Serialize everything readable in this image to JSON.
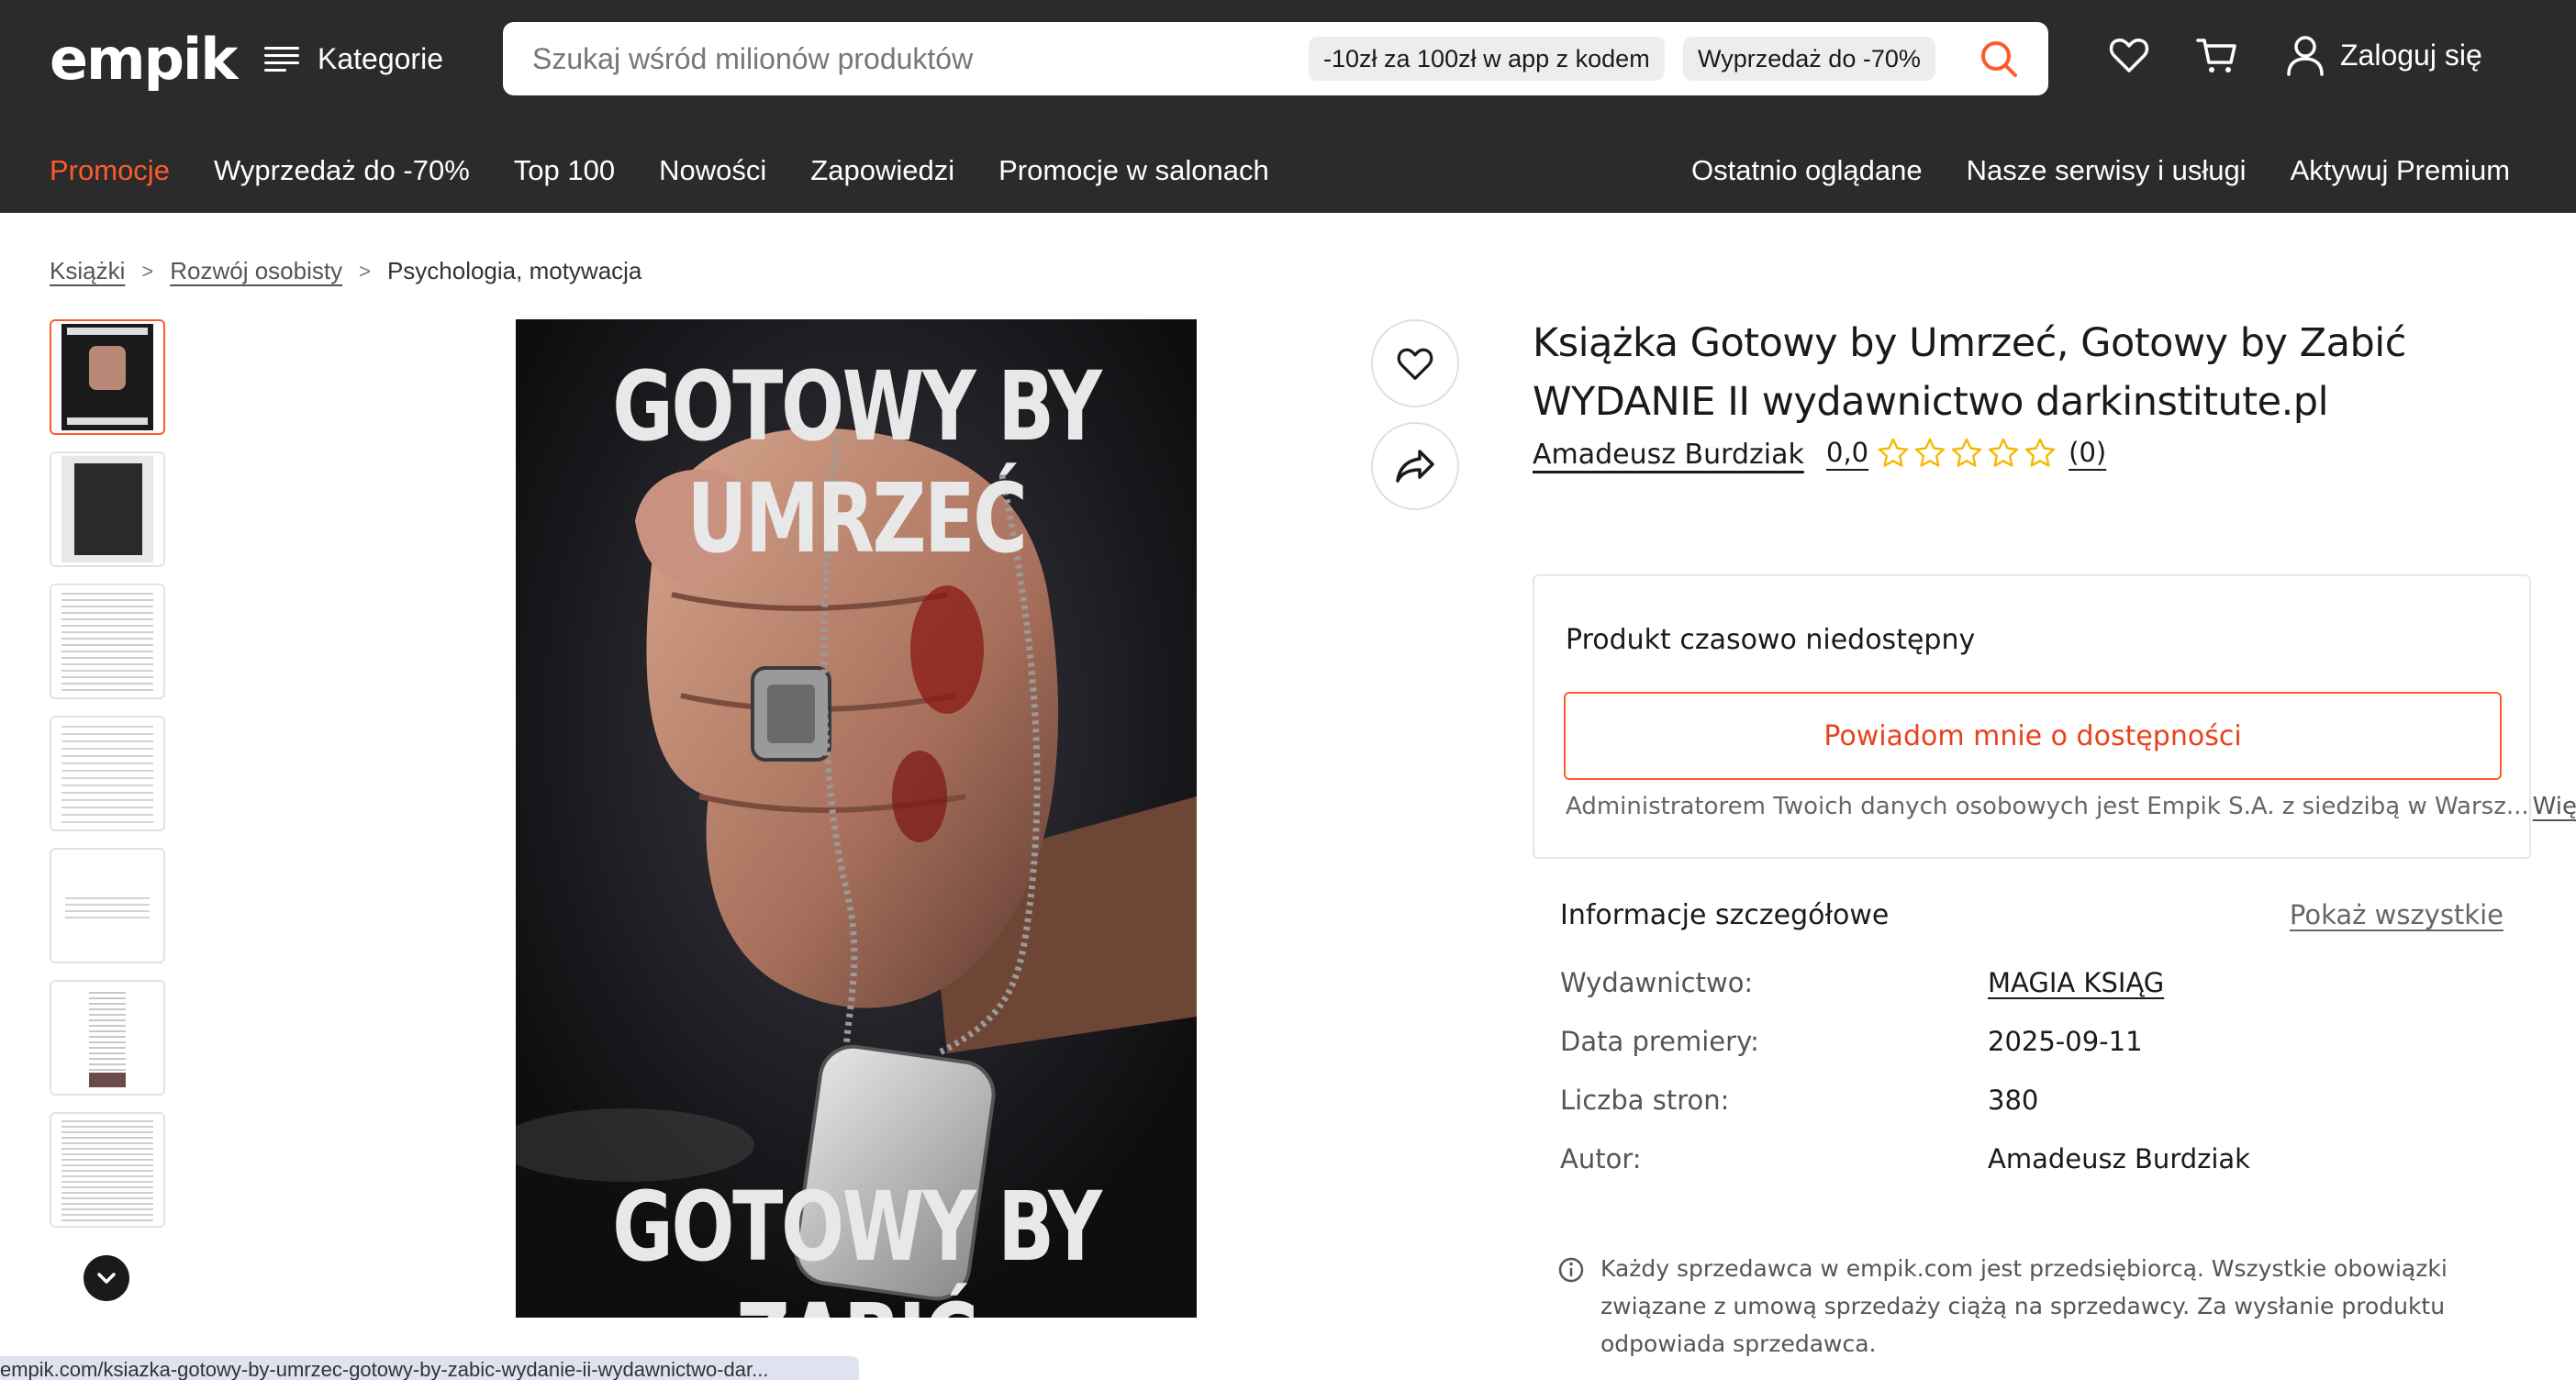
{
  "header": {
    "logo": "empik",
    "categories_label": "Kategorie",
    "search_placeholder": "Szukaj wśród milionów produktów",
    "chip_1": "-10zł za 100zł w app z kodem",
    "chip_2": "Wyprzedaż do -70%",
    "login_label": "Zaloguj się"
  },
  "nav": {
    "left": [
      "Promocje",
      "Wyprzedaż do -70%",
      "Top 100",
      "Nowości",
      "Zapowiedzi",
      "Promocje w salonach"
    ],
    "right": [
      "Ostatnio oglądane",
      "Nasze serwisy i usługi",
      "Aktywuj Premium"
    ]
  },
  "breadcrumb": {
    "items": [
      "Książki",
      "Rozwój osobisty",
      "Psychologia, motywacja"
    ],
    "separator": ">"
  },
  "cover": {
    "top_text": "GOTOWY BY UMRZEĆ",
    "bottom_text": "GOTOWY BY ZABIĆ",
    "tag_text": "GOTOWY BY UMRZEĆ GOTOWY BY ZABIĆ"
  },
  "product": {
    "title": "Książka Gotowy by Umrzeć, Gotowy by Zabić WYDANIE II wydawnictwo darkinstitute.pl",
    "author": "Amadeusz Burdziak",
    "rating_value": "0,0",
    "rating_stars": 0,
    "rating_max": 5,
    "review_count": "(0)"
  },
  "availability": {
    "status": "Produkt czasowo niedostępny",
    "notify_button": "Powiadom mnie o dostępności",
    "admin_text": "Administratorem Twoich danych osobowych jest Empik S.A. z siedzibą w Warsz...",
    "more_link": "Więcej"
  },
  "details": {
    "heading": "Informacje szczegółowe",
    "show_all": "Pokaż wszystkie",
    "rows": [
      {
        "key": "Wydawnictwo:",
        "value": "MAGIA KSIĄG"
      },
      {
        "key": "Data premiery:",
        "value": "2025-09-11"
      },
      {
        "key": "Liczba stron:",
        "value": "380"
      },
      {
        "key": "Autor:",
        "value": "Amadeusz Burdziak"
      }
    ]
  },
  "seller_notice": {
    "line_1": "Każdy sprzedawca w empik.com jest przedsiębiorcą. Wszystkie obowiązki",
    "line_2": "związane z umową sprzedaży ciążą na sprzedawcy. Za wysłanie produktu",
    "line_3": "odpowiada sprzedawca."
  },
  "status_bar": {
    "url": "empik.com/ksiazka-gotowy-by-umrzec-gotowy-by-zabic-wydanie-ii-wydawnictwo-dar..."
  },
  "colors": {
    "header_bg": "#2b2b2b",
    "accent": "#ff5a2b",
    "star": "#f5b800"
  },
  "icons": {
    "search": "search-icon",
    "wishlist": "heart-icon",
    "cart": "cart-icon",
    "user": "user-icon",
    "share": "share-icon",
    "info": "info-icon",
    "scroll_down": "chevron-down-icon"
  }
}
